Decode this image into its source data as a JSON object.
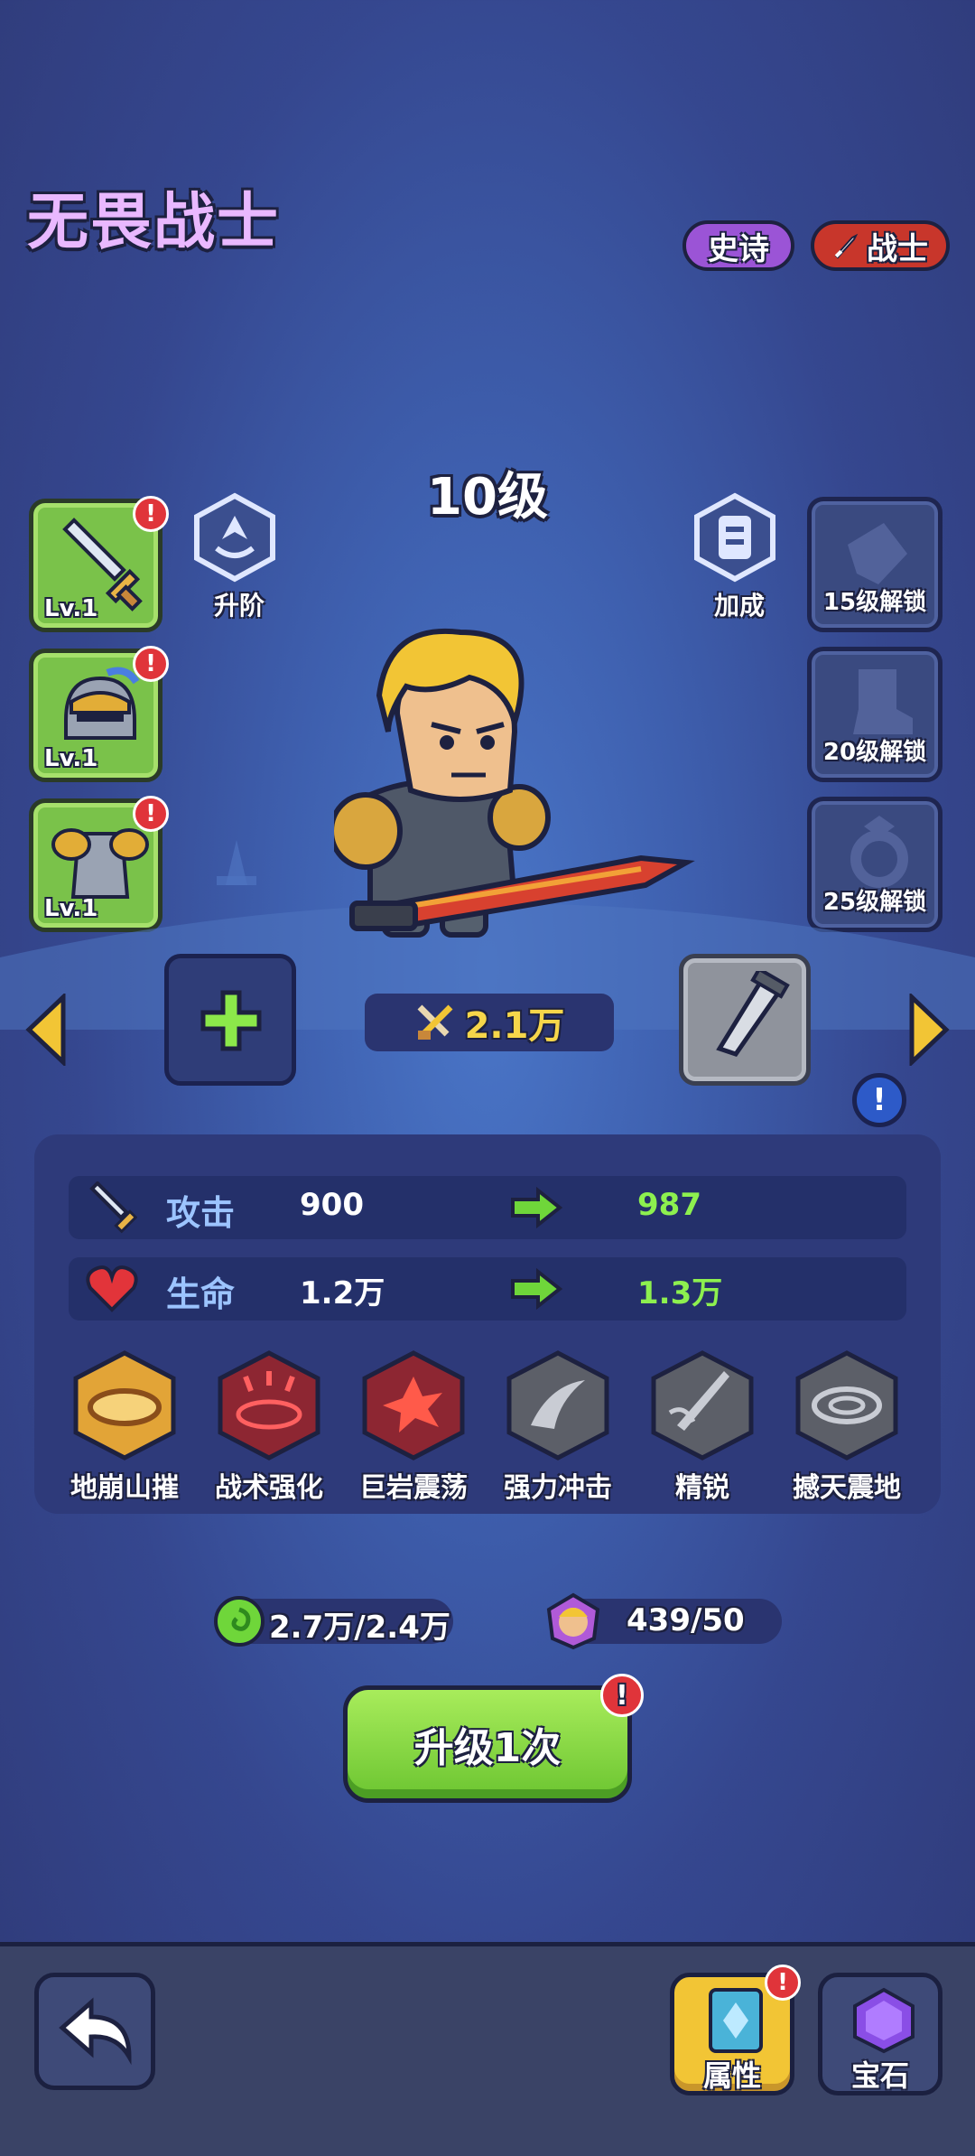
{
  "hero": {
    "name": "无畏战士",
    "rarity": "史诗",
    "class": "战士",
    "level": "10级",
    "power": "2.1万"
  },
  "equipment": [
    {
      "slot": "weapon",
      "level": "Lv.1"
    },
    {
      "slot": "helmet",
      "level": "Lv.1"
    },
    {
      "slot": "armor",
      "level": "Lv.1"
    }
  ],
  "locked_slots": [
    {
      "label": "15级解锁"
    },
    {
      "label": "20级解锁"
    },
    {
      "label": "25级解锁"
    }
  ],
  "actions": {
    "ascend_label": "升阶",
    "bonus_label": "加成"
  },
  "stats": [
    {
      "name": "攻击",
      "current": "900",
      "next": "987"
    },
    {
      "name": "生命",
      "current": "1.2万",
      "next": "1.3万"
    }
  ],
  "skills": [
    {
      "name": "地崩山摧",
      "unlocked": true
    },
    {
      "name": "战术强化",
      "unlocked": true
    },
    {
      "name": "巨岩震荡",
      "unlocked": true
    },
    {
      "name": "强力冲击",
      "unlocked": false
    },
    {
      "name": "精锐",
      "unlocked": false
    },
    {
      "name": "撼天震地",
      "unlocked": false
    }
  ],
  "resources": {
    "exp": "2.7万/2.4万",
    "shards": "439/50"
  },
  "upgrade_button": "升级1次",
  "bottom_nav": {
    "attributes_label": "属性",
    "gems_label": "宝石"
  },
  "badge_symbol": "!",
  "colors": {
    "title": "#e9b8ff",
    "rarity_epic": "#9b54d6",
    "class_warrior": "#c8362b",
    "stat_next": "#8df04f",
    "equip_slot": "#7ac24a"
  }
}
